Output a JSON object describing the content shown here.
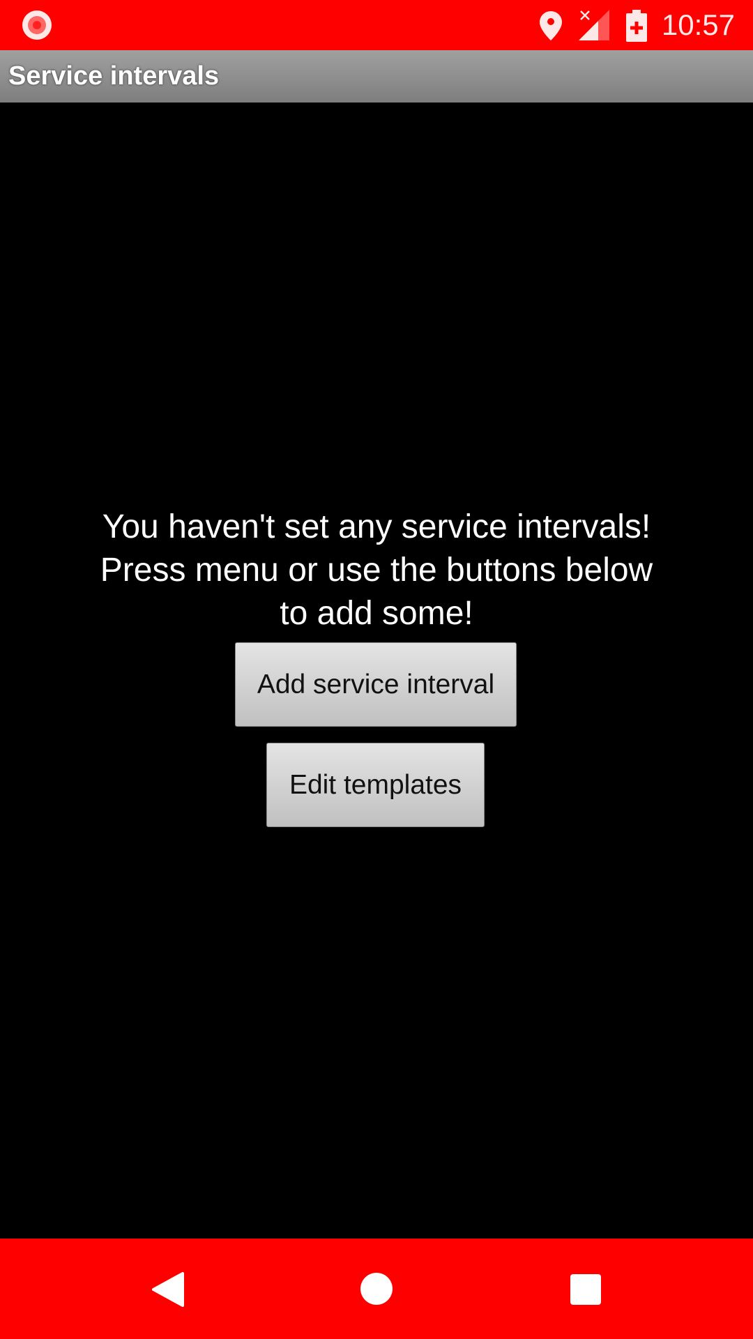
{
  "status_bar": {
    "time": "10:57",
    "icons": [
      "screen-record-icon",
      "location-icon",
      "signal-no-data-icon",
      "battery-charging-icon"
    ]
  },
  "app_bar": {
    "title": "Service intervals"
  },
  "empty_state": {
    "lines": [
      "You haven't set any service intervals!",
      "Press menu or use the buttons below",
      "to add some!"
    ]
  },
  "buttons": {
    "add": "Add service interval",
    "edit": "Edit templates"
  },
  "colors": {
    "status_bar": "#ff0000",
    "nav_bar": "#ff0000",
    "background": "#000000"
  }
}
